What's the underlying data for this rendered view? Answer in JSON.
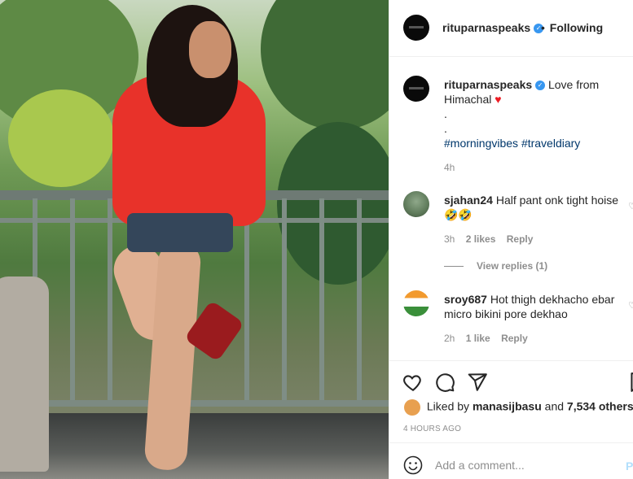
{
  "header": {
    "username": "rituparnaspeaks",
    "follow_dot": "•",
    "follow_status": "Following"
  },
  "caption": {
    "username": "rituparnaspeaks",
    "text": "Love from Himachal",
    "heart": "♥",
    "dot1": ".",
    "dot2": ".",
    "hashtags": "#morningvibes #traveldiary",
    "time": "4h"
  },
  "comments": [
    {
      "username": "sjahan24",
      "text": "Half pant onk tight hoise",
      "emoji": "🤣🤣",
      "time": "3h",
      "likes": "2 likes",
      "reply": "Reply",
      "view_replies": "View replies (1)"
    },
    {
      "username": "sroy687",
      "text": "Hot thigh dekhacho ebar micro bikini pore dekhao",
      "time": "2h",
      "likes": "1 like",
      "reply": "Reply"
    }
  ],
  "actions": {
    "liked_by_prefix": "Liked by",
    "liked_by_user": "manasijbasu",
    "liked_by_and": "and",
    "liked_by_others": "7,534 others",
    "time_ago": "4 HOURS AGO"
  },
  "add_comment": {
    "placeholder": "Add a comment...",
    "post": "P"
  },
  "icons": {
    "verified": "verified-badge-icon",
    "like": "heart-outline-icon",
    "comment": "comment-bubble-icon",
    "share": "paper-plane-icon",
    "save": "bookmark-icon",
    "emoji": "smiley-icon"
  },
  "colors": {
    "verified": "#3897f0",
    "link": "#00376b",
    "muted": "#8e8e8e",
    "heart": "#ed1c24"
  }
}
